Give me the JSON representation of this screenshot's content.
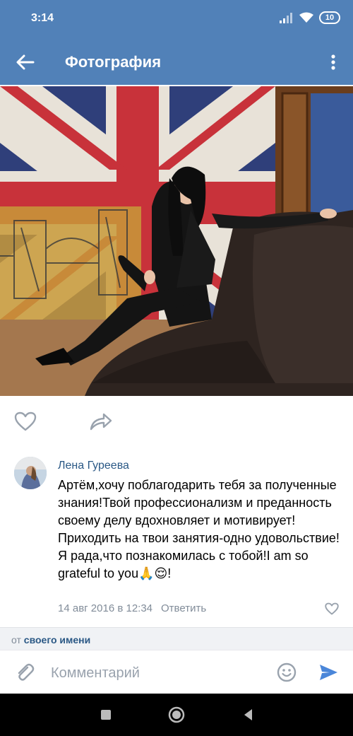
{
  "status_bar": {
    "time": "3:14",
    "battery": "10"
  },
  "app_bar": {
    "title": "Фотография"
  },
  "comment": {
    "author": "Лена Гуреева",
    "text": "Артём,хочу поблагодарить тебя за полученные знания!Твой профессионализм и преданность своему делу вдохновляет и мотивирует!Приходить на твои занятия-одно удовольствие!Я рада,что познакомилась с тобой!I am so grateful to you🙏😌!",
    "date": "14 авг 2016 в 12:34",
    "reply_label": "Ответить"
  },
  "sender": {
    "prefix": "от",
    "name": "своего имени"
  },
  "composer": {
    "placeholder": "Комментарий"
  },
  "icons": {
    "back": "arrow-left-icon",
    "menu": "more-vertical-icon",
    "like": "heart-icon",
    "share": "share-icon",
    "attach": "paperclip-icon",
    "emoji": "smile-icon",
    "send": "send-icon"
  },
  "colors": {
    "header": "#5181b8",
    "link": "#2a5885",
    "meta": "#818c99",
    "send": "#4a86d9"
  }
}
